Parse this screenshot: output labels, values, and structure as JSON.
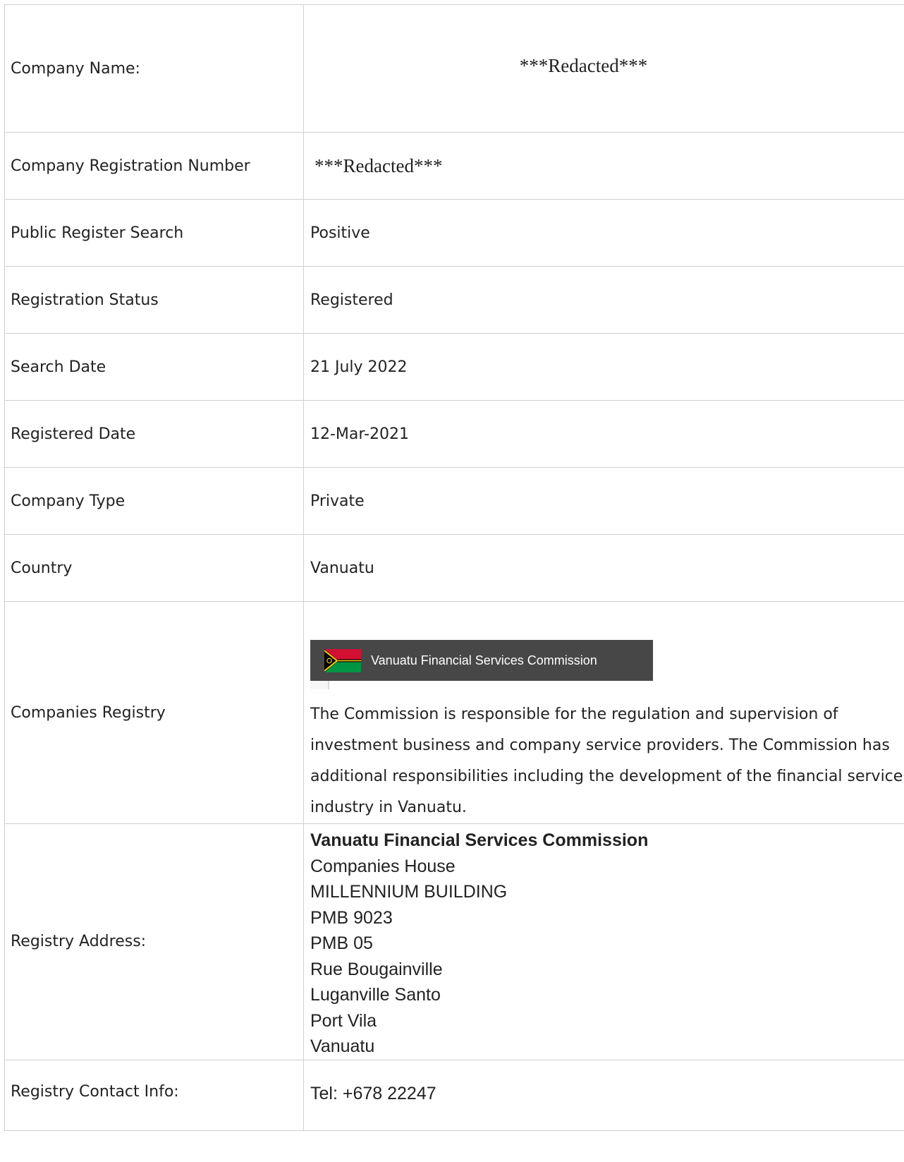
{
  "rows": {
    "company_name": {
      "label": "Company Name:",
      "value": "***Redacted***"
    },
    "registration_number": {
      "label": "Company Registration Number",
      "value": "***Redacted***"
    },
    "public_register_search": {
      "label": "Public Register Search",
      "value": "Positive"
    },
    "registration_status": {
      "label": "Registration Status",
      "value": "Registered"
    },
    "search_date": {
      "label": "Search Date",
      "value": "21 July 2022"
    },
    "registered_date": {
      "label": "Registered Date",
      "value": "12-Mar-2021"
    },
    "company_type": {
      "label": "Company Type",
      "value": "Private"
    },
    "country": {
      "label": "Country",
      "value": "Vanuatu"
    },
    "companies_registry": {
      "label": "Companies Registry",
      "banner_text": "Vanuatu Financial Services Commission",
      "banner_icon": "vanuatu-flag-icon",
      "description": "The Commission is responsible for the regulation and supervision of investment business and company service providers. The Commission has additional responsibilities including the development of the financial service industry in Vanuatu."
    },
    "registry_address": {
      "label": "Registry Address:",
      "name": "Vanuatu Financial Services Commission",
      "lines": [
        "Companies House",
        "MILLENNIUM BUILDING",
        "PMB 9023",
        "PMB 05",
        "Rue Bougainville",
        "Luganville Santo",
        "Port Vila",
        "Vanuatu"
      ]
    },
    "registry_contact": {
      "label": "Registry Contact Info:",
      "value": "Tel: +678 22247"
    }
  },
  "colors": {
    "border": "#cfcfcf",
    "banner_bg": "#474747",
    "flag_red": "#d21034",
    "flag_green": "#009543",
    "flag_black": "#000000",
    "flag_yellow": "#fdce12"
  }
}
